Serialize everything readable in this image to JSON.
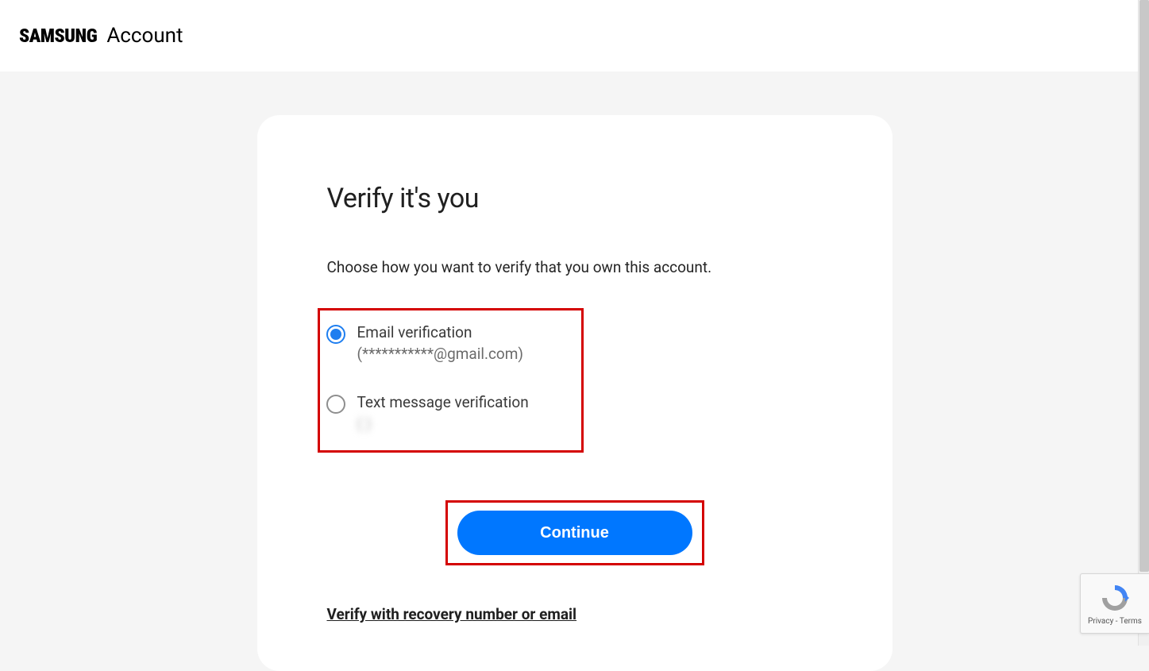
{
  "header": {
    "brand_main": "SAMSUNG",
    "brand_sub": "Account"
  },
  "card": {
    "title": "Verify it's you",
    "subtitle": "Choose how you want to verify that you own this account.",
    "options": [
      {
        "label": "Email verification",
        "detail": "(***********@gmail.com)",
        "selected": true
      },
      {
        "label": "Text message verification",
        "detail": "(              )",
        "selected": false
      }
    ],
    "continue_label": "Continue",
    "recovery_link": "Verify with recovery number or email"
  },
  "recaptcha": {
    "legal": "Privacy - Terms"
  }
}
